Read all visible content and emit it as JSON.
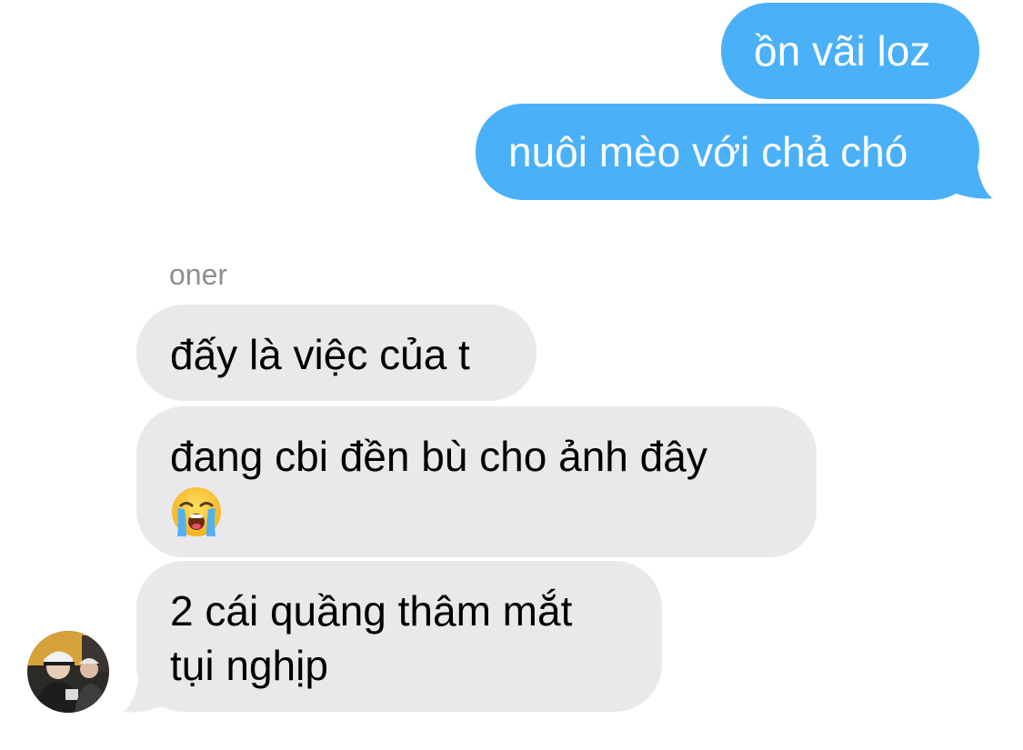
{
  "conversation": {
    "outgoing": [
      {
        "text": "ồn vãi loz"
      },
      {
        "text": "nuôi mèo với chả chó"
      }
    ],
    "incoming_sender": "oner",
    "incoming": [
      {
        "lines": [
          "đấy là việc của t"
        ]
      },
      {
        "lines": [
          "đang cbi đền bù cho ảnh đây"
        ],
        "emoji": "loudly-crying-face-emoji"
      },
      {
        "lines": [
          "2 cái quầng thâm mắt",
          "tụi nghịp"
        ]
      }
    ]
  },
  "colors": {
    "outgoing_bubble": "#4ab0f8",
    "incoming_bubble": "#e9e9eb",
    "sender_name": "#8e8e93",
    "background": "#ffffff"
  },
  "icons": {
    "avatar": "contact-photo-avatar",
    "reaction": "loudly-crying-face-emoji"
  }
}
